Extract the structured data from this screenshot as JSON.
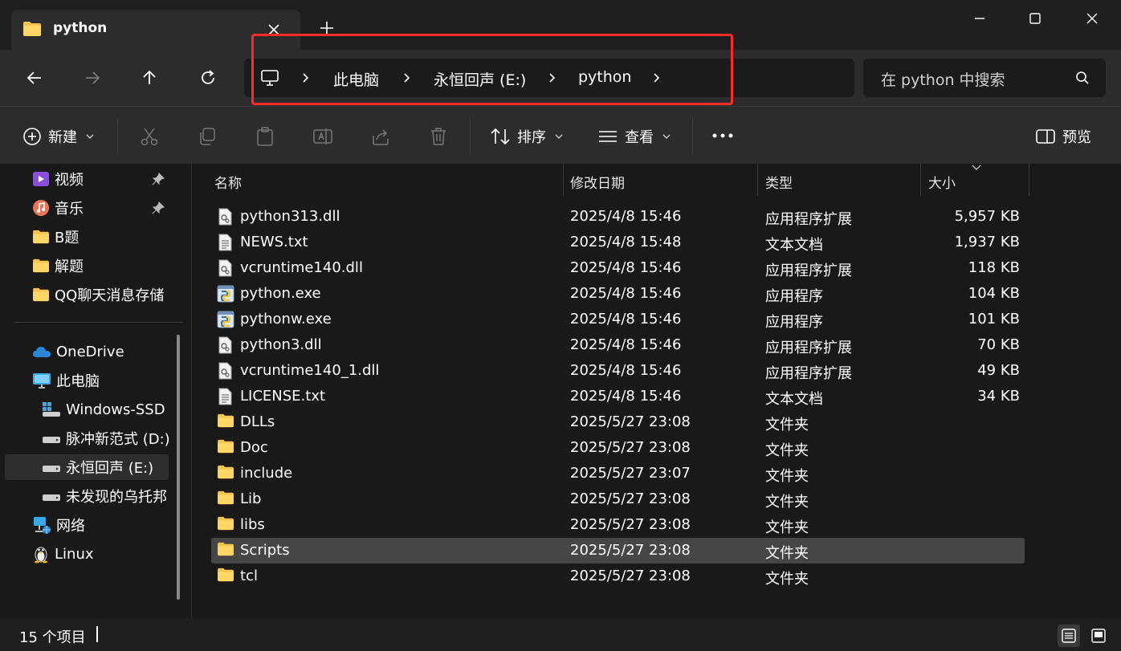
{
  "tab": {
    "title": "python"
  },
  "address": {
    "segments": [
      "此电脑",
      "永恒回声 (E:)",
      "python"
    ]
  },
  "search": {
    "placeholder": "在 python 中搜索"
  },
  "commands": {
    "new_label": "新建",
    "sort_label": "排序",
    "view_label": "查看",
    "preview_label": "预览"
  },
  "sidebar": {
    "items": [
      {
        "label": "视频"
      },
      {
        "label": "音乐"
      },
      {
        "label": "B题"
      },
      {
        "label": "解题"
      },
      {
        "label": "QQ聊天消息存储"
      },
      {
        "label": "OneDrive"
      },
      {
        "label": "此电脑"
      },
      {
        "label": "Windows-SSD ("
      },
      {
        "label": "脉冲新范式 (D:)"
      },
      {
        "label": "永恒回声 (E:)"
      },
      {
        "label": "未发现的乌托邦"
      },
      {
        "label": "网络"
      },
      {
        "label": "Linux"
      }
    ]
  },
  "columns": {
    "name": "名称",
    "modified": "修改日期",
    "type": "类型",
    "size": "大小"
  },
  "files": [
    {
      "name": "python313.dll",
      "modified": "2025/4/8 15:46",
      "type": "应用程序扩展",
      "size": "5,957 KB",
      "icon": "dll"
    },
    {
      "name": "NEWS.txt",
      "modified": "2025/4/8 15:48",
      "type": "文本文档",
      "size": "1,937 KB",
      "icon": "txt"
    },
    {
      "name": "vcruntime140.dll",
      "modified": "2025/4/8 15:46",
      "type": "应用程序扩展",
      "size": "118 KB",
      "icon": "dll"
    },
    {
      "name": "python.exe",
      "modified": "2025/4/8 15:46",
      "type": "应用程序",
      "size": "104 KB",
      "icon": "exe"
    },
    {
      "name": "pythonw.exe",
      "modified": "2025/4/8 15:46",
      "type": "应用程序",
      "size": "101 KB",
      "icon": "exe"
    },
    {
      "name": "python3.dll",
      "modified": "2025/4/8 15:46",
      "type": "应用程序扩展",
      "size": "70 KB",
      "icon": "dll"
    },
    {
      "name": "vcruntime140_1.dll",
      "modified": "2025/4/8 15:46",
      "type": "应用程序扩展",
      "size": "49 KB",
      "icon": "dll"
    },
    {
      "name": "LICENSE.txt",
      "modified": "2025/4/8 15:46",
      "type": "文本文档",
      "size": "34 KB",
      "icon": "txt"
    },
    {
      "name": "DLLs",
      "modified": "2025/5/27 23:08",
      "type": "文件夹",
      "size": "",
      "icon": "folder"
    },
    {
      "name": "Doc",
      "modified": "2025/5/27 23:08",
      "type": "文件夹",
      "size": "",
      "icon": "folder"
    },
    {
      "name": "include",
      "modified": "2025/5/27 23:07",
      "type": "文件夹",
      "size": "",
      "icon": "folder"
    },
    {
      "name": "Lib",
      "modified": "2025/5/27 23:08",
      "type": "文件夹",
      "size": "",
      "icon": "folder"
    },
    {
      "name": "libs",
      "modified": "2025/5/27 23:08",
      "type": "文件夹",
      "size": "",
      "icon": "folder"
    },
    {
      "name": "Scripts",
      "modified": "2025/5/27 23:08",
      "type": "文件夹",
      "size": "",
      "icon": "folder",
      "selected": true
    },
    {
      "name": "tcl",
      "modified": "2025/5/27 23:08",
      "type": "文件夹",
      "size": "",
      "icon": "folder"
    }
  ],
  "status": {
    "count_text": "15 个项目"
  },
  "colors": {
    "highlight_box": "#ff2a2a",
    "selection": "#464646",
    "folder": "#f4c54a"
  }
}
